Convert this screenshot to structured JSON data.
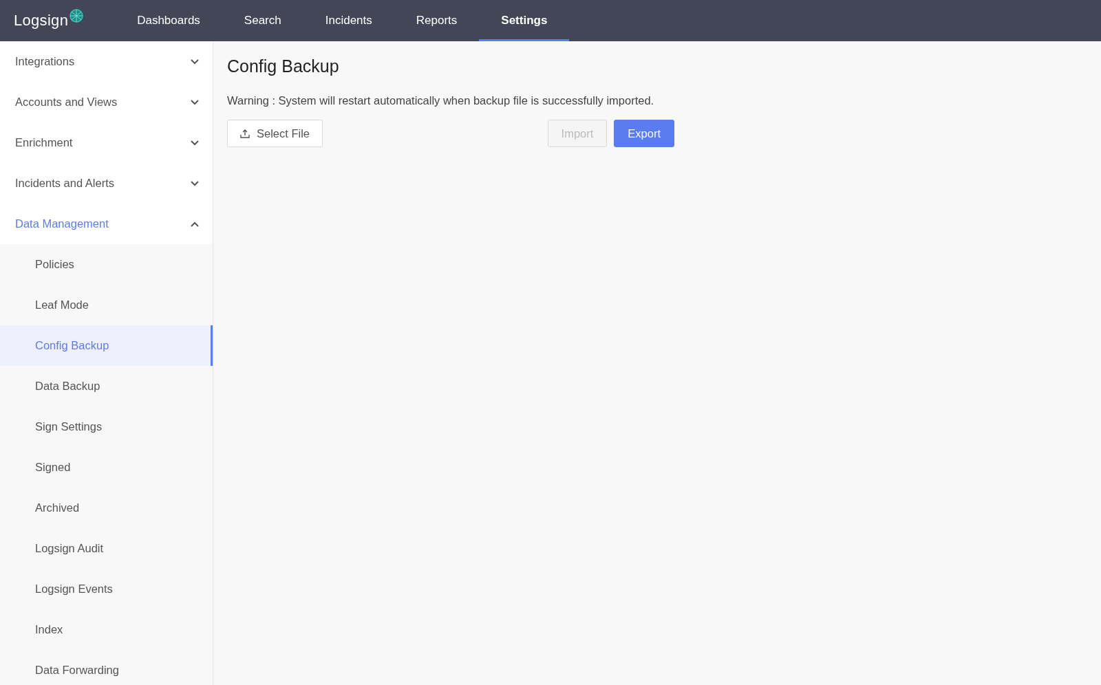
{
  "logo": {
    "text": "Logsign"
  },
  "nav": [
    {
      "label": "Dashboards",
      "selected": false
    },
    {
      "label": "Search",
      "selected": false
    },
    {
      "label": "Incidents",
      "selected": false
    },
    {
      "label": "Reports",
      "selected": false
    },
    {
      "label": "Settings",
      "selected": true
    }
  ],
  "sidebar": {
    "items": [
      {
        "label": "Integrations",
        "expanded": false,
        "selected": false
      },
      {
        "label": "Accounts and Views",
        "expanded": false,
        "selected": false
      },
      {
        "label": "Enrichment",
        "expanded": false,
        "selected": false
      },
      {
        "label": "Incidents and Alerts",
        "expanded": false,
        "selected": false
      },
      {
        "label": "Data Management",
        "expanded": true,
        "selected": true,
        "children": [
          {
            "label": "Policies",
            "selected": false
          },
          {
            "label": "Leaf Mode",
            "selected": false
          },
          {
            "label": "Config Backup",
            "selected": true
          },
          {
            "label": "Data Backup",
            "selected": false
          },
          {
            "label": "Sign Settings",
            "selected": false
          },
          {
            "label": "Signed",
            "selected": false
          },
          {
            "label": "Archived",
            "selected": false
          },
          {
            "label": "Logsign Audit",
            "selected": false
          },
          {
            "label": "Logsign Events",
            "selected": false
          },
          {
            "label": "Index",
            "selected": false
          },
          {
            "label": "Data Forwarding",
            "selected": false
          }
        ]
      }
    ]
  },
  "content": {
    "title": "Config Backup",
    "warning": "Warning : System will restart automatically when backup file is successfully imported.",
    "select_file": {
      "label": "Select File"
    },
    "buttons": [
      {
        "label": "Import",
        "kind": "secondary",
        "disabled": true
      },
      {
        "label": "Export",
        "kind": "primary",
        "disabled": false
      }
    ]
  }
}
